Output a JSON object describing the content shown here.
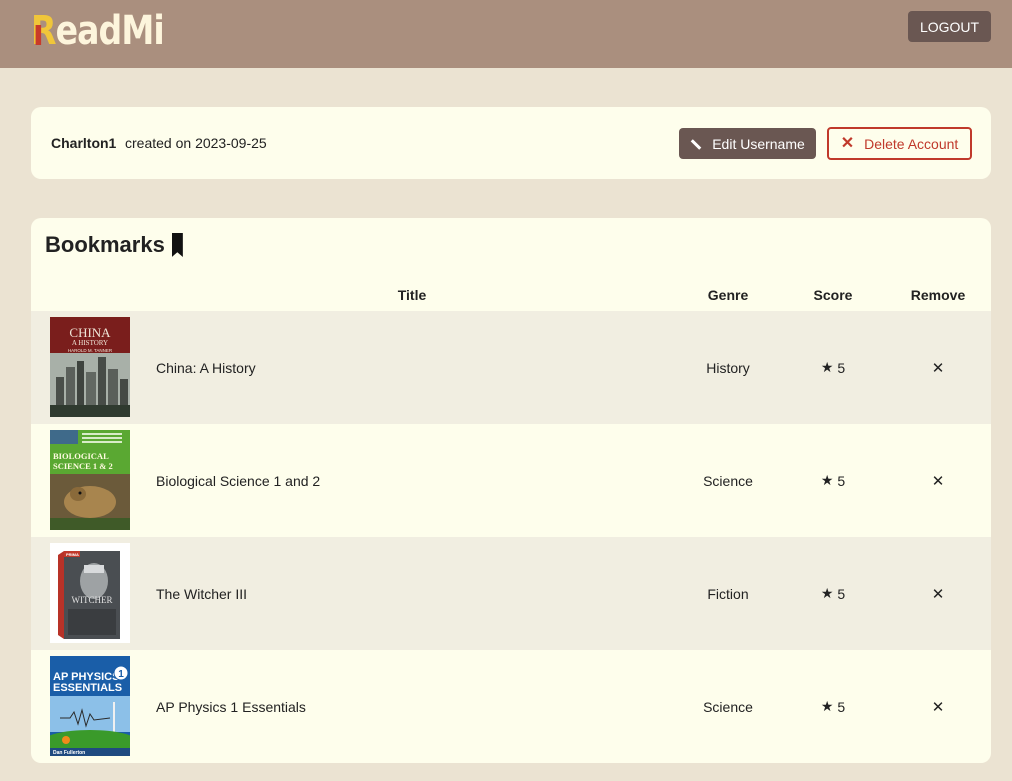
{
  "app": {
    "logo": "ReadMi",
    "logo_first": "R",
    "logo_rest": "eadMi",
    "logout_label": "LOGOUT"
  },
  "user": {
    "username": "Charlton1",
    "created_prefix": "created on",
    "created_date": "2023-09-25"
  },
  "actions": {
    "edit_label": "Edit Username",
    "delete_label": "Delete Account"
  },
  "bookmarks": {
    "heading": "Bookmarks",
    "columns": {
      "title": "Title",
      "genre": "Genre",
      "score": "Score",
      "remove": "Remove"
    },
    "rows": [
      {
        "title": "China: A History",
        "genre": "History",
        "score": "5",
        "cover": {
          "line1": "CHINA",
          "line2": "A HISTORY",
          "author": "HAROLD M. TANNER"
        }
      },
      {
        "title": "Biological Science 1 and 2",
        "genre": "Science",
        "score": "5",
        "cover": {
          "line1": "BIOLOGICAL",
          "line2": "SCIENCE 1 & 2"
        }
      },
      {
        "title": "The Witcher III",
        "genre": "Fiction",
        "score": "5",
        "cover": {
          "publisher": "PRIMA",
          "line1": "WITCHER"
        }
      },
      {
        "title": "AP Physics 1 Essentials",
        "genre": "Science",
        "score": "5",
        "cover": {
          "line1": "AP PHYSICS",
          "line2": "ESSENTIALS",
          "number": "1",
          "author": "Dan Fullerton"
        }
      }
    ]
  },
  "icons": {
    "star": "★",
    "remove": "✕",
    "delete": "✕"
  },
  "colors": {
    "header": "#aa8f7e",
    "background": "#ebe3d2",
    "card": "#fefeec",
    "button": "#6a5752",
    "danger": "#c0392b",
    "logo_accent": "#f0c63a"
  }
}
